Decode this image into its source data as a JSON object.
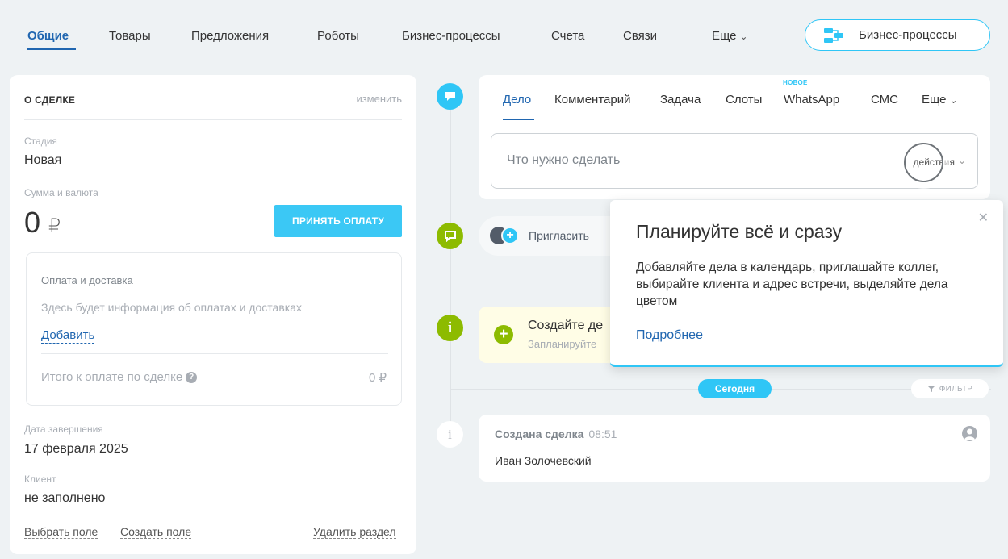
{
  "top_tabs": {
    "general": "Общие",
    "products": "Товары",
    "offers": "Предложения",
    "robots": "Роботы",
    "bizproc": "Бизнес-процессы",
    "invoices": "Счета",
    "links": "Связи",
    "more": "Еще"
  },
  "bizproc_button": {
    "label": "Бизнес-процессы"
  },
  "deal": {
    "title": "О СДЕЛКЕ",
    "edit": "изменить",
    "stage_label": "Стадия",
    "stage_value": "Новая",
    "amount_label": "Сумма и валюта",
    "amount_value": "0",
    "currency": "₽",
    "pay_button": "ПРИНЯТЬ ОПЛАТУ",
    "payment": {
      "title": "Оплата и доставка",
      "info": "Здесь будет информация об оплатах и доставках",
      "add": "Добавить",
      "total_label": "Итого к оплате по сделке",
      "total_value": "0 ₽"
    },
    "close_date_label": "Дата завершения",
    "close_date_value": "17 февраля 2025",
    "client_label": "Клиент",
    "client_value": "не заполнено",
    "select_field": "Выбрать поле",
    "create_field": "Создать поле",
    "delete_section": "Удалить раздел"
  },
  "editor": {
    "tabs": {
      "task": "Дело",
      "comment": "Комментарий",
      "todo": "Задача",
      "slots": "Слоты",
      "whatsapp": "WhatsApp",
      "sms": "СМС",
      "more": "Еще"
    },
    "new_badge": "НОВОЕ",
    "placeholder": "Что нужно сделать",
    "actions": "действия"
  },
  "invite": {
    "label": "Пригласить"
  },
  "create_deal": {
    "title": "Создайте де",
    "subtitle": "Запланируйте"
  },
  "today": "Сегодня",
  "filter": "ФИЛЬТР",
  "history": {
    "title": "Создана сделка",
    "time": "08:51",
    "user": "Иван Золочевский"
  },
  "popup": {
    "title": "Планируйте всё и сразу",
    "text": "Добавляйте дела в календарь, приглашайте коллег, выбирайте клиента и адрес встречи, выделяйте дела цветом",
    "link": "Подробнее"
  },
  "colors": {
    "accent": "#2066b0",
    "cyan": "#2fc6f6",
    "green": "#8dbb00",
    "yellow_bg": "#fffde6"
  }
}
